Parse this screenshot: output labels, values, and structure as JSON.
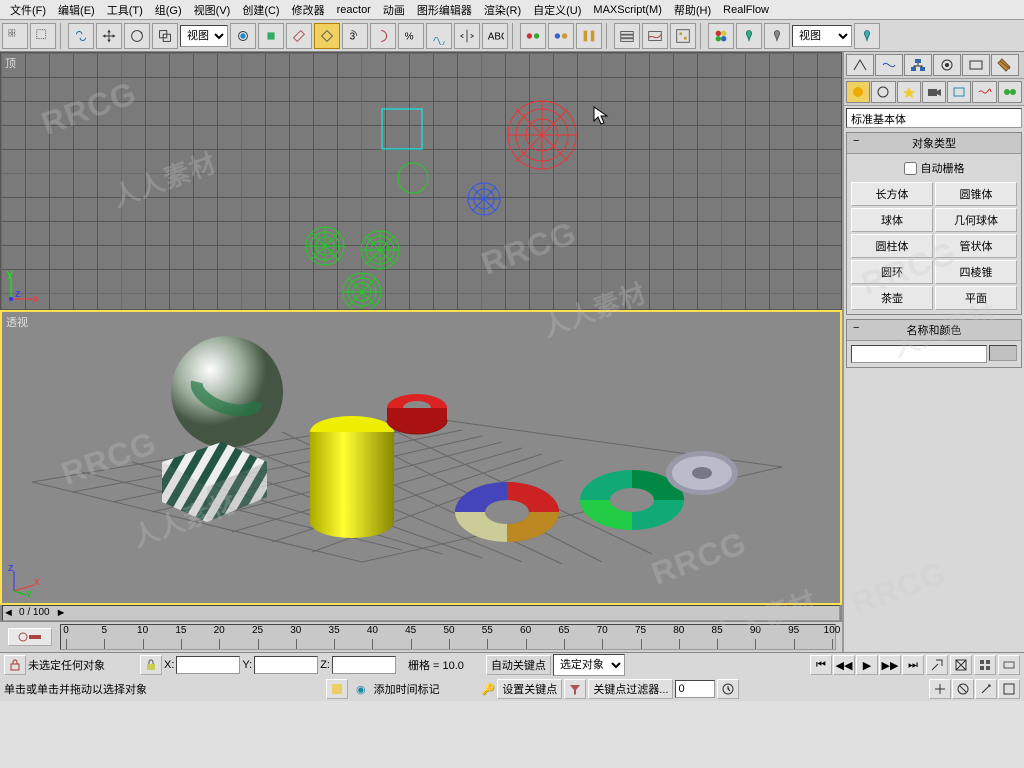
{
  "menu": [
    "文件(F)",
    "编辑(E)",
    "工具(T)",
    "组(G)",
    "视图(V)",
    "创建(C)",
    "修改器",
    "reactor",
    "动画",
    "图形编辑器",
    "渲染(R)",
    "自定义(U)",
    "MAXScript(M)",
    "帮助(H)",
    "RealFlow"
  ],
  "toolbar": {
    "dropdown1": "视图",
    "dropdown2": "视图"
  },
  "viewports": {
    "top_label": "顶",
    "persp_label": "透视"
  },
  "slider": {
    "frame": "0 / 100"
  },
  "timeline": {
    "ticks": [
      0,
      5,
      10,
      15,
      20,
      25,
      30,
      35,
      40,
      45,
      50,
      55,
      60,
      65,
      70,
      75,
      80,
      85,
      90,
      95,
      100
    ]
  },
  "cmd": {
    "category": "标准基本体",
    "roll_type": "对象类型",
    "autogrid": "自动栅格",
    "prims": [
      "长方体",
      "圆锥体",
      "球体",
      "几何球体",
      "圆柱体",
      "管状体",
      "圆环",
      "四棱锥",
      "茶壶",
      "平面"
    ],
    "roll_color": "名称和颜色"
  },
  "status": {
    "no_sel": "未选定任何对象",
    "hint": "单击或单击并拖动以选择对象",
    "x": "X:",
    "y": "Y:",
    "z": "Z:",
    "grid": "栅格 = 10.0",
    "autokey": "自动关键点",
    "selobj": "选定对象",
    "setkey": "设置关键点",
    "keyfilter": "关键点过滤器...",
    "add_marker": "添加时间标记"
  },
  "watermark": {
    "en": "RRCG",
    "cn": "人人素材"
  }
}
